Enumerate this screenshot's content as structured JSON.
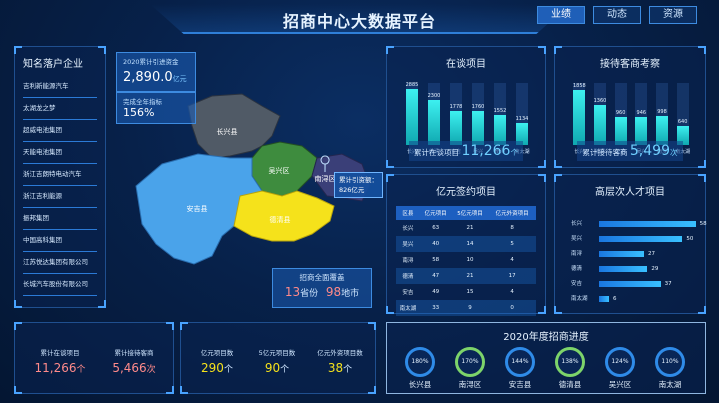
{
  "header": {
    "title": "招商中心大数据平台",
    "tabs": [
      {
        "label": "业绩",
        "active": true
      },
      {
        "label": "动态",
        "active": false
      },
      {
        "label": "资源",
        "active": false
      }
    ]
  },
  "companies": {
    "title": "知名落户企业",
    "items": [
      "吉利新能源汽车",
      "太湖龙之梦",
      "超威电池集团",
      "天能电池集团",
      "浙江吉朗特电动汽车",
      "浙江吉利能源",
      "振邦集团",
      "中国高科集团",
      "江苏悦达集团有限公司",
      "长城汽车股份有限公司"
    ]
  },
  "map": {
    "capital": {
      "label": "2020累计引进资金",
      "value": "2,890.0",
      "unit": "亿元"
    },
    "target": {
      "label": "完成全年指标",
      "value": "156%"
    },
    "regions": [
      {
        "name": "长兴县",
        "color": "#505a66"
      },
      {
        "name": "吴兴区",
        "color": "#3e8c3e"
      },
      {
        "name": "南浔区",
        "color": "#4a5290"
      },
      {
        "name": "安吉县",
        "color": "#4aa3ea"
      },
      {
        "name": "德清县",
        "color": "#f5e21b"
      }
    ],
    "tooltip": {
      "line1": "累计引资额：",
      "line2": "826亿元"
    },
    "coverage": {
      "label": "招商全面覆盖",
      "provinces": "13",
      "province_unit": "省份",
      "cities": "98",
      "city_unit": "地市"
    }
  },
  "projects": {
    "title": "在谈项目",
    "chart_data": {
      "type": "bar",
      "categories": [
        "长兴",
        "德清",
        "安吉",
        "吴兴",
        "南浔",
        "南太湖"
      ],
      "values": [
        2885,
        2300,
        1778,
        1760,
        1552,
        1134
      ],
      "ylim": [
        0,
        3200
      ]
    },
    "total_label": "累计在谈项目",
    "total_value": "11,266",
    "total_unit": "个"
  },
  "guests": {
    "title": "接待客商考察",
    "chart_data": {
      "type": "bar",
      "categories": [
        "长兴",
        "德清",
        "安吉",
        "吴兴",
        "南浔",
        "南太湖"
      ],
      "values": [
        1858,
        1360,
        960,
        946,
        998,
        640
      ],
      "ylim": [
        0,
        2100
      ]
    },
    "total_label": "累计接待客商",
    "total_value": "5,499",
    "total_unit": "次"
  },
  "contracts": {
    "title": "亿元签约项目",
    "chart_data": {
      "type": "table",
      "columns": [
        "区县",
        "亿元项目",
        "5亿元项目",
        "亿元外资项目"
      ],
      "rows": [
        [
          "长兴",
          "63",
          "21",
          "8"
        ],
        [
          "吴兴",
          "40",
          "14",
          "5"
        ],
        [
          "南浔",
          "58",
          "10",
          "4"
        ],
        [
          "德清",
          "47",
          "21",
          "17"
        ],
        [
          "安吉",
          "49",
          "15",
          "4"
        ],
        [
          "南太湖",
          "33",
          "9",
          "0"
        ]
      ]
    }
  },
  "talents": {
    "title": "高层次人才项目",
    "chart_data": {
      "type": "bar",
      "categories": [
        "长兴",
        "吴兴",
        "南浔",
        "德清",
        "安吉",
        "南太湖"
      ],
      "values": [
        58,
        50,
        27,
        29,
        37,
        6
      ],
      "xlim": [
        0,
        60
      ]
    }
  },
  "bottom_left": {
    "items": [
      {
        "label": "累计在谈项目",
        "value": "11,266",
        "unit": "个",
        "color": "#ff8a8a"
      },
      {
        "label": "累计接待客商",
        "value": "5,466",
        "unit": "次",
        "color": "#ff8a8a"
      }
    ]
  },
  "bottom_mid": {
    "items": [
      {
        "label": "亿元项目数",
        "value": "290",
        "unit": "个",
        "color": "#f5e21b"
      },
      {
        "label": "5亿元项目数",
        "value": "90",
        "unit": "个",
        "color": "#f5e21b"
      },
      {
        "label": "亿元外资项目数",
        "value": "38",
        "unit": "个",
        "color": "#f5e21b"
      }
    ]
  },
  "progress": {
    "title": "2020年度招商进度",
    "items": [
      {
        "name": "长兴县",
        "percent": "180%",
        "color": "blue"
      },
      {
        "name": "南浔区",
        "percent": "170%",
        "color": "green"
      },
      {
        "name": "安吉县",
        "percent": "144%",
        "color": "blue"
      },
      {
        "name": "德清县",
        "percent": "138%",
        "color": "green"
      },
      {
        "name": "吴兴区",
        "percent": "124%",
        "color": "blue"
      },
      {
        "name": "南太湖",
        "percent": "110%",
        "color": "blue"
      }
    ]
  }
}
